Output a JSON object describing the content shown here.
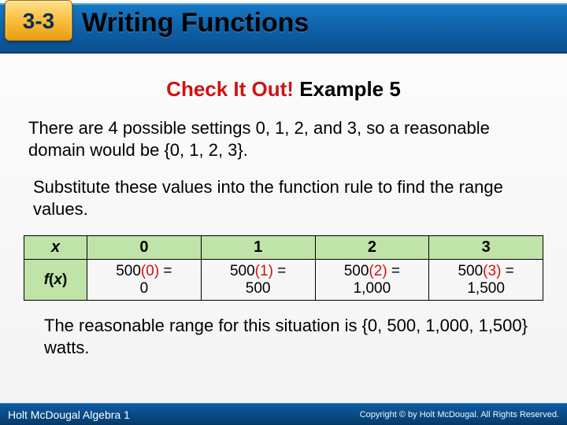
{
  "header": {
    "badge": "3-3",
    "title": "Writing Functions"
  },
  "check": {
    "prefix": "Check It Out!",
    "suffix": " Example 5"
  },
  "para1": "There are 4 possible settings  0, 1, 2, and 3, so a reasonable domain would be {0, 1, 2, 3}.",
  "para2": "Substitute these values into the function rule to find the range values.",
  "table": {
    "xlabel": "x",
    "fxlabel": {
      "f": "f",
      "open": "(",
      "x": "x",
      "close": ")"
    },
    "cols": [
      {
        "x": "0",
        "pre": "500",
        "arg": "(0)",
        "eq": " =",
        "res": "0"
      },
      {
        "x": "1",
        "pre": "500",
        "arg": "(1)",
        "eq": " =",
        "res": "500"
      },
      {
        "x": "2",
        "pre": "500",
        "arg": "(2)",
        "eq": " =",
        "res": "1,000"
      },
      {
        "x": "3",
        "pre": "500",
        "arg": "(3)",
        "eq": " =",
        "res": "1,500"
      }
    ]
  },
  "conclusion": "The reasonable range for this situation is {0, 500, 1,000, 1,500} watts.",
  "footer": {
    "book": "Holt McDougal Algebra 1",
    "copy": "Copyright © by Holt McDougal. All Rights Reserved."
  }
}
